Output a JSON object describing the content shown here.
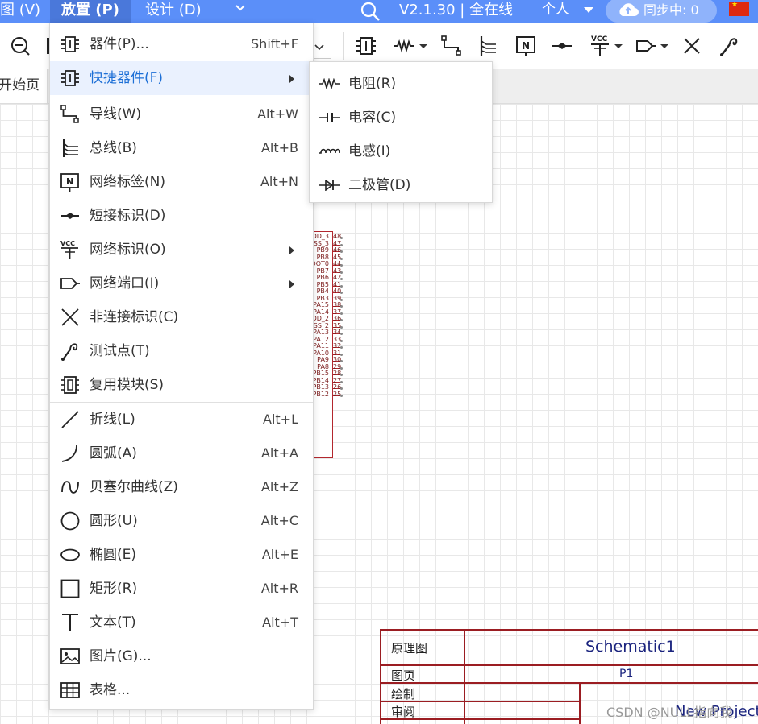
{
  "menubar": {
    "view": "图 (V)",
    "place": "放置 (P)",
    "design": "设计 (D)",
    "version": "V2.1.30 | 全在线",
    "user": "个人",
    "sync": "同步中: 0"
  },
  "tabs": {
    "start": "开始页"
  },
  "place_menu": {
    "items": [
      {
        "label": "器件(P)...",
        "shortcut": "Shift+F",
        "icon": "component-icon"
      },
      {
        "label": "快捷器件(F)",
        "shortcut": "",
        "icon": "quick-component-icon",
        "submenu": true
      },
      {
        "label": "导线(W)",
        "shortcut": "Alt+W",
        "icon": "wire-icon"
      },
      {
        "label": "总线(B)",
        "shortcut": "Alt+B",
        "icon": "bus-icon"
      },
      {
        "label": "网络标签(N)",
        "shortcut": "Alt+N",
        "icon": "net-label-icon"
      },
      {
        "label": "短接标识(D)",
        "shortcut": "",
        "icon": "short-flag-icon"
      },
      {
        "label": "网络标识(O)",
        "shortcut": "",
        "icon": "net-flag-icon",
        "submenu": true
      },
      {
        "label": "网络端口(I)",
        "shortcut": "",
        "icon": "net-port-icon",
        "submenu": true
      },
      {
        "label": "非连接标识(C)",
        "shortcut": "",
        "icon": "no-connect-icon"
      },
      {
        "label": "测试点(T)",
        "shortcut": "",
        "icon": "probe-icon"
      },
      {
        "label": "复用模块(S)",
        "shortcut": "",
        "icon": "reuse-block-icon"
      },
      {
        "label": "折线(L)",
        "shortcut": "Alt+L",
        "icon": "polyline-icon"
      },
      {
        "label": "圆弧(A)",
        "shortcut": "Alt+A",
        "icon": "arc-icon"
      },
      {
        "label": "贝塞尔曲线(Z)",
        "shortcut": "Alt+Z",
        "icon": "bezier-icon"
      },
      {
        "label": "圆形(U)",
        "shortcut": "Alt+C",
        "icon": "circle-icon"
      },
      {
        "label": "椭圆(E)",
        "shortcut": "Alt+E",
        "icon": "ellipse-icon"
      },
      {
        "label": "矩形(R)",
        "shortcut": "Alt+R",
        "icon": "rectangle-icon"
      },
      {
        "label": "文本(T)",
        "shortcut": "Alt+T",
        "icon": "text-icon"
      },
      {
        "label": "图片(G)...",
        "shortcut": "",
        "icon": "image-icon"
      },
      {
        "label": "表格...",
        "shortcut": "",
        "icon": "table-icon"
      }
    ]
  },
  "quick_submenu": {
    "items": [
      {
        "label": "电阻(R)",
        "icon": "resistor-icon"
      },
      {
        "label": "电容(C)",
        "icon": "capacitor-icon"
      },
      {
        "label": "电感(I)",
        "icon": "inductor-icon"
      },
      {
        "label": "二极管(D)",
        "icon": "diode-icon"
      }
    ]
  },
  "chip": {
    "pins": [
      {
        "name": "DD_3",
        "num": "48"
      },
      {
        "name": "SS_3",
        "num": "47"
      },
      {
        "name": "PB9",
        "num": "46"
      },
      {
        "name": "PB8",
        "num": "45"
      },
      {
        "name": "OOT0",
        "num": "44"
      },
      {
        "name": "PB7",
        "num": "43"
      },
      {
        "name": "PB6",
        "num": "42"
      },
      {
        "name": "PB5",
        "num": "41"
      },
      {
        "name": "PB4",
        "num": "40"
      },
      {
        "name": "PB3",
        "num": "39"
      },
      {
        "name": "PA15",
        "num": "38"
      },
      {
        "name": "PA14",
        "num": "37"
      },
      {
        "name": "DD_2",
        "num": "36"
      },
      {
        "name": "SS_2",
        "num": "35"
      },
      {
        "name": "PA13",
        "num": "34"
      },
      {
        "name": "PA12",
        "num": "33"
      },
      {
        "name": "PA11",
        "num": "32"
      },
      {
        "name": "PA10",
        "num": "31"
      },
      {
        "name": "PA9",
        "num": "30"
      },
      {
        "name": "PA8",
        "num": "29"
      },
      {
        "name": "PB15",
        "num": "28"
      },
      {
        "name": "PB14",
        "num": "27"
      },
      {
        "name": "PB13",
        "num": "26"
      },
      {
        "name": "PB12",
        "num": "25"
      }
    ]
  },
  "title_block": {
    "type_label": "原理图",
    "schematic_name": "Schematic1",
    "page_label": "图页",
    "page_value": "P1",
    "drawn_label": "绘制",
    "review_label": "审阅",
    "project_name": "New Project"
  },
  "watermark": "CSDN @NULL指向我",
  "colors": {
    "menubar": "#5b8ff9",
    "menubar_active": "#4a78da",
    "accent": "#1d6fd6",
    "schematic_line": "#9b1d22"
  }
}
